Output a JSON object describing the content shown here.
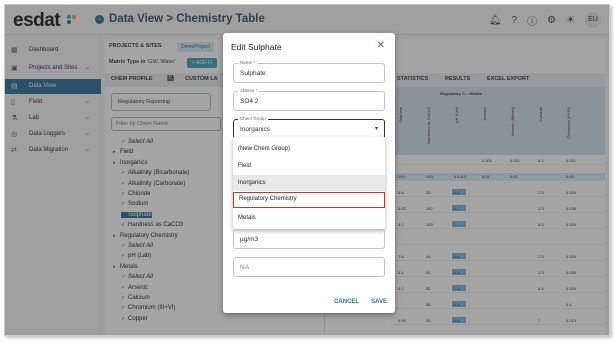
{
  "app": {
    "logo": "esdat",
    "breadcrumb": "Data View > Chemistry Table",
    "user_initials": "EU"
  },
  "sidebar": {
    "items": [
      {
        "label": "Dashboard",
        "icon": "grid-icon"
      },
      {
        "label": "Projects and Sites",
        "icon": "projects-icon"
      },
      {
        "label": "Data View",
        "icon": "dataview-icon"
      },
      {
        "label": "Field",
        "icon": "field-icon"
      },
      {
        "label": "Lab",
        "icon": "lab-icon"
      },
      {
        "label": "Data Loggers",
        "icon": "logger-icon"
      },
      {
        "label": "Data Migration",
        "icon": "migration-icon"
      }
    ]
  },
  "main": {
    "projects_sites": "PROJECTS & SITES",
    "project_chip": "DemoProject",
    "matrix_type_label": "Matrix Type in",
    "matrix_type_value": "'GW, Water'",
    "add_filter": "+ ADD FI",
    "chem_profile": "CHEM PROFILE",
    "custom_la": "CUSTOM LA",
    "statistics": "STATISTICS",
    "results": "RESULTS",
    "excel_export": "EXCEL EXPORT",
    "regulatory_reporting": "Regulatory Reporting",
    "filter_placeholder": "Filter by Chem Name",
    "grid_header": "Regulatory C... Metals",
    "tree": [
      {
        "label": "Select All",
        "italic": true,
        "indent": 1
      },
      {
        "label": "Field",
        "indent": 0
      },
      {
        "label": "Inorganics",
        "indent": 0
      },
      {
        "label": "Alkalinity (Bicarbonate)",
        "indent": 1
      },
      {
        "label": "Alkalinity (Carbonate)",
        "indent": 1
      },
      {
        "label": "Chloride",
        "indent": 1
      },
      {
        "label": "Sodium",
        "indent": 1
      },
      {
        "label": "Sulphate",
        "indent": 1,
        "selected": true
      },
      {
        "label": "Hardness as CaCO3",
        "indent": 1
      },
      {
        "label": "Regulatory Chemistry",
        "indent": 0
      },
      {
        "label": "Select All",
        "italic": true,
        "indent": 1
      },
      {
        "label": "pH (Lab)",
        "indent": 1
      },
      {
        "label": "Metals",
        "indent": 0
      },
      {
        "label": "Select All",
        "italic": true,
        "indent": 1
      },
      {
        "label": "Arsenic",
        "indent": 1
      },
      {
        "label": "Calcium",
        "indent": 1
      },
      {
        "label": "Chromium (III+VI)",
        "indent": 1
      },
      {
        "label": "Copper",
        "indent": 1
      }
    ],
    "grid_columns": [
      "Sulphate",
      "Hardness as CaCO3",
      "pH (Lab)",
      "Arsenic",
      "Arsenic (filtered)",
      "Calcium",
      "Chromium (III+VI)"
    ],
    "grid_rows": [
      [
        "",
        "",
        "",
        "0.001",
        "0.001",
        "0.1",
        "0.001"
      ],
      [
        "200",
        "200",
        "6.5-8.5",
        "0.01",
        "0.01",
        "",
        "0.05"
      ],
      [
        "5.6",
        "33",
        "0.3",
        "",
        "",
        "7.3",
        "0.004"
      ],
      [
        "0.02",
        "182",
        "0.7",
        "",
        "",
        "1.3",
        "0.038"
      ],
      [
        "4.7",
        "109",
        "7",
        "",
        "",
        "6.6",
        "0.004"
      ],
      [
        "",
        "",
        "",
        "",
        "",
        "",
        ""
      ],
      [
        "7.6",
        "44",
        "0.4",
        "",
        "",
        "7.3",
        "0.004"
      ],
      [
        "0.1",
        "91",
        "0.1",
        "",
        "",
        "1.3",
        "0.036"
      ],
      [
        "4.7",
        "52",
        "7.3",
        "",
        "",
        "6.4",
        "0.004"
      ],
      [
        "",
        "86",
        "0.1",
        "",
        "",
        "",
        "0.1"
      ],
      [
        "0.99",
        "45",
        "0.5",
        "",
        "",
        "7",
        "0.013"
      ]
    ]
  },
  "dialog": {
    "title": "Edit Sulphate",
    "name_label": "Name *",
    "name_value": "Sulphate",
    "abbrev_label": "Abbrev *",
    "abbrev_value": "SO4 2",
    "chem_group_label": "Chem Group",
    "chem_group_value": "Inorganics",
    "options": [
      "(New Chem Group)",
      "Field",
      "Inorganics",
      "Regulatory Chemistry",
      "Metals"
    ],
    "selected_option": "Inorganics",
    "highlighted_option": "Regulatory Chemistry",
    "units_value": "µg/m3",
    "na_value": "NA",
    "cancel_label": "CANCEL",
    "save_label": "SAVE"
  },
  "colors": {
    "accent": "#2a6f97",
    "highlight_border": "#d32f2f",
    "grid_blue": "#7fb7dd"
  }
}
